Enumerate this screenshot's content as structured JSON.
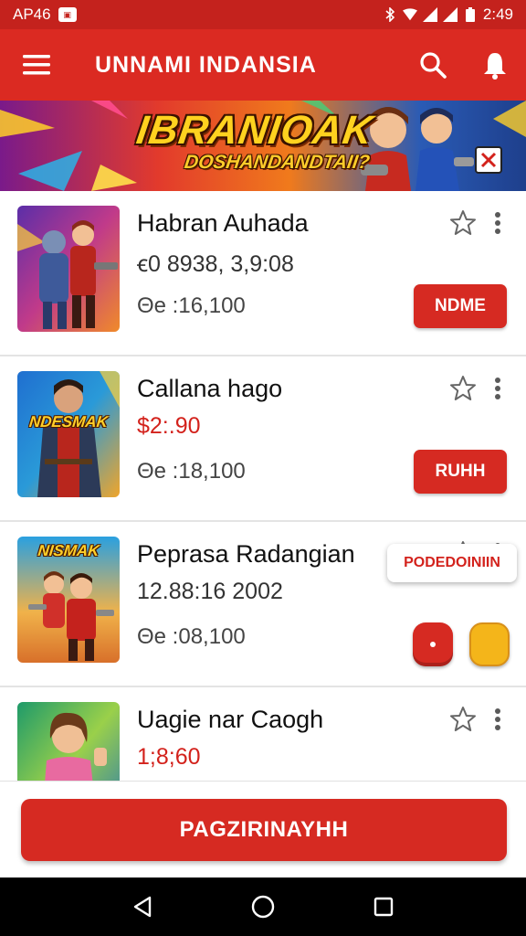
{
  "status_bar": {
    "carrier": "AP46",
    "time": "2:49"
  },
  "app_bar": {
    "title": "UNNAMI INDANSIA"
  },
  "banner": {
    "title": "IBRANIOAK",
    "subtitle": "DOSHANDANDTAII?"
  },
  "items": [
    {
      "title": "Habran Auhada",
      "subtitle": "ꞓ0 8938, 3,9:08",
      "meta": "Θe :16,100",
      "button": "NDME"
    },
    {
      "title": "Callana hago",
      "subtitle": "$2:.90",
      "meta": "Θe :18,100",
      "button": "RUHH",
      "thumb_text": "NDESMAK"
    },
    {
      "title": "Peprasa Radangian",
      "subtitle": "12.88:16 2002",
      "meta": "Θe :08,100",
      "thumb_text": "NISMAK"
    },
    {
      "title": "Uagie nar Caogh",
      "subtitle": "1;8;60",
      "chip": "PODEDOINIIN"
    }
  ],
  "cta": {
    "label": "PAGZIRINAYHH"
  },
  "colors": {
    "primary": "#db2a22",
    "status_bar": "#c4221d",
    "price": "#d3221c",
    "round_red": "#d62a22",
    "round_yellow": "#f4b51a"
  },
  "icons": {
    "menu": "menu-icon",
    "search": "search-icon",
    "notifications": "bell-icon",
    "favorite": "star-outline-icon",
    "more": "more-vertical-icon",
    "back": "back-triangle-icon",
    "home": "home-circle-icon",
    "recents": "recents-square-icon"
  }
}
